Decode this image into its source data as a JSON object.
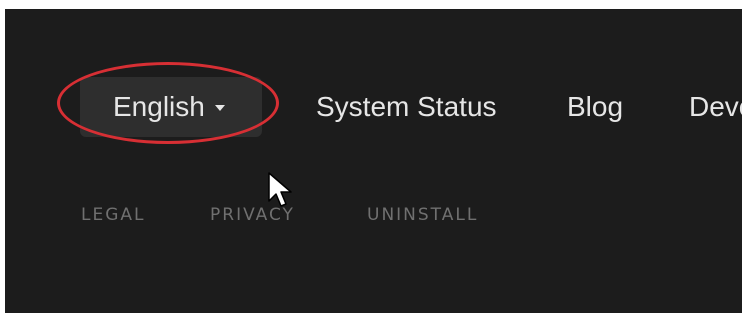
{
  "nav": {
    "language_selector": {
      "label": "English",
      "caret_icon": "caret-down-icon"
    },
    "links": [
      "System Status",
      "Blog",
      "Deve"
    ]
  },
  "footer": {
    "links": [
      "LEGAL",
      "PRIVACY",
      "UNINSTALL"
    ]
  },
  "annotation": {
    "color": "#d72f34",
    "shape": "ellipse"
  },
  "colors": {
    "background": "#1c1c1c",
    "button_bg": "#2e2e2e",
    "text": "#e6e6e6",
    "footer_text": "#707070"
  },
  "pointer_icon": "mouse-pointer-icon"
}
